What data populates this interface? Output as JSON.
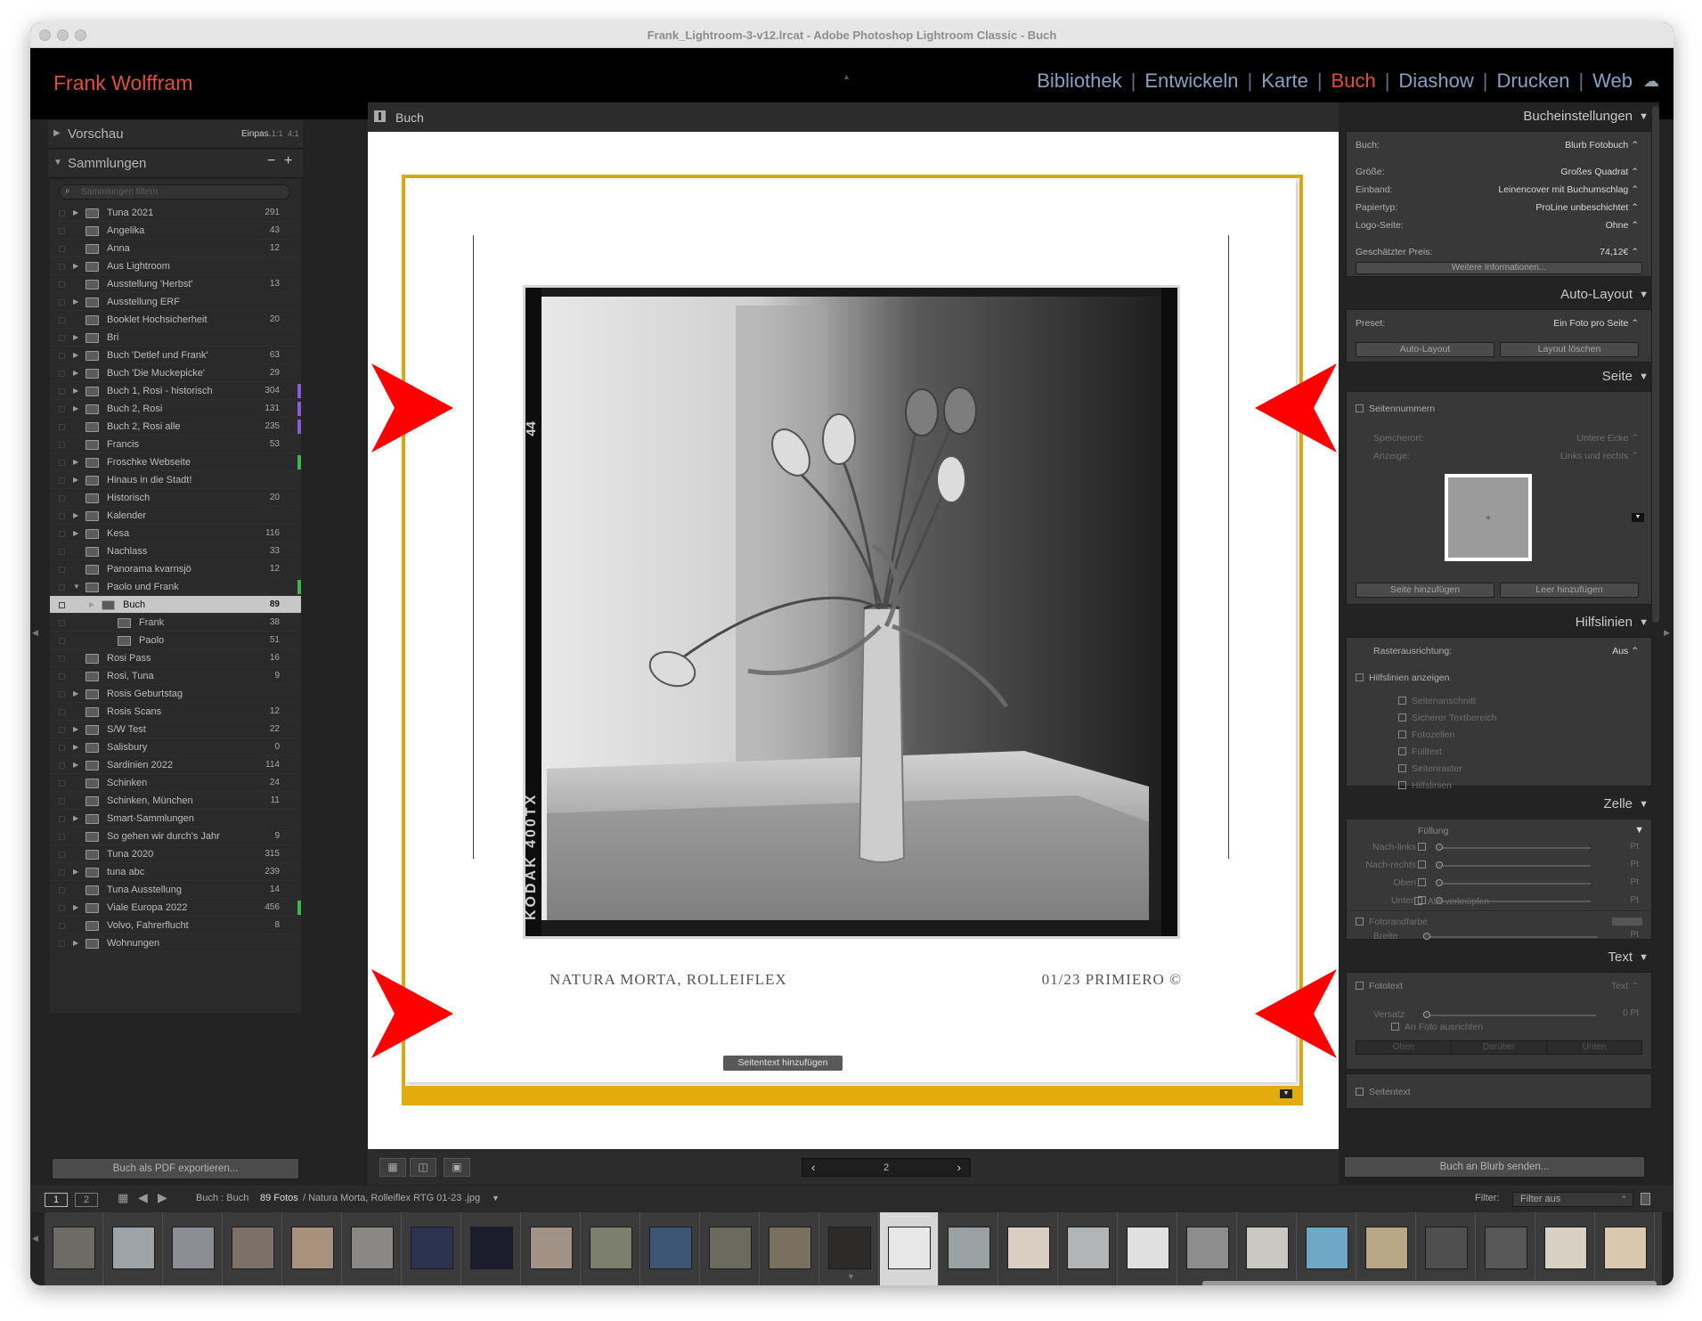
{
  "window": {
    "title": "Frank_Lightroom-3-v12.lrcat - Adobe Photoshop Lightroom Classic - Buch"
  },
  "identity_plate": "Frank Wolffram",
  "modules": [
    {
      "label": "Bibliothek",
      "active": false
    },
    {
      "label": "Entwickeln",
      "active": false
    },
    {
      "label": "Karte",
      "active": false
    },
    {
      "label": "Buch",
      "active": true
    },
    {
      "label": "Diashow",
      "active": false
    },
    {
      "label": "Drucken",
      "active": false
    },
    {
      "label": "Web",
      "active": false
    }
  ],
  "left": {
    "preview": {
      "label": "Vorschau",
      "fit": "Einpas.",
      "z1": "1:1",
      "z2": "4:1"
    },
    "collections": {
      "label": "Sammlungen",
      "search_placeholder": "Sammlungen filtern",
      "items": [
        {
          "name": "Tuna 2021",
          "count": "291",
          "expand": true,
          "tag": ""
        },
        {
          "name": "Angelika",
          "count": "43",
          "expand": false,
          "tag": ""
        },
        {
          "name": "Anna",
          "count": "12",
          "expand": false,
          "tag": ""
        },
        {
          "name": "Aus Lightroom",
          "count": "",
          "expand": true,
          "tag": ""
        },
        {
          "name": "Ausstellung 'Herbst'",
          "count": "13",
          "expand": false,
          "tag": ""
        },
        {
          "name": "Ausstellung ERF",
          "count": "",
          "expand": true,
          "tag": ""
        },
        {
          "name": "Booklet Hochsicherheit",
          "count": "20",
          "expand": false,
          "tag": ""
        },
        {
          "name": "Bri",
          "count": "",
          "expand": true,
          "tag": ""
        },
        {
          "name": "Buch 'Detlef und Frank'",
          "count": "63",
          "expand": true,
          "tag": ""
        },
        {
          "name": "Buch 'Die Muckepicke'",
          "count": "29",
          "expand": true,
          "tag": ""
        },
        {
          "name": "Buch 1, Rosi - historisch",
          "count": "304",
          "expand": true,
          "tag": "#8a5bd6"
        },
        {
          "name": "Buch 2, Rosi",
          "count": "131",
          "expand": true,
          "tag": "#8a5bd6"
        },
        {
          "name": "Buch 2, Rosi alle",
          "count": "235",
          "expand": false,
          "tag": "#8a5bd6"
        },
        {
          "name": "Francis",
          "count": "53",
          "expand": false,
          "tag": ""
        },
        {
          "name": "Froschke Webseite",
          "count": "",
          "expand": true,
          "tag": "#3fb34f"
        },
        {
          "name": "Hinaus in die Stadt!",
          "count": "",
          "expand": true,
          "tag": ""
        },
        {
          "name": "Historisch",
          "count": "20",
          "expand": false,
          "tag": ""
        },
        {
          "name": "Kalender",
          "count": "",
          "expand": true,
          "tag": ""
        },
        {
          "name": "Kesa",
          "count": "116",
          "expand": true,
          "tag": ""
        },
        {
          "name": "Nachlass",
          "count": "33",
          "expand": false,
          "tag": ""
        },
        {
          "name": "Panorama kvarnsjö",
          "count": "12",
          "expand": false,
          "tag": ""
        },
        {
          "name": "Paolo und Frank",
          "count": "",
          "expand": true,
          "open": true,
          "tag": "#3fb34f"
        },
        {
          "name": "Buch",
          "count": "89",
          "expand": true,
          "selected": true,
          "level": 1,
          "tag": ""
        },
        {
          "name": "Frank",
          "count": "38",
          "expand": false,
          "level": 2,
          "tag": ""
        },
        {
          "name": "Paolo",
          "count": "51",
          "expand": false,
          "level": 2,
          "tag": ""
        },
        {
          "name": "Rosi Pass",
          "count": "16",
          "expand": false,
          "tag": ""
        },
        {
          "name": "Rosi, Tuna",
          "count": "9",
          "expand": false,
          "tag": ""
        },
        {
          "name": "Rosis Geburtstag",
          "count": "",
          "expand": true,
          "tag": ""
        },
        {
          "name": "Rosis Scans",
          "count": "12",
          "expand": false,
          "tag": ""
        },
        {
          "name": "S/W Test",
          "count": "22",
          "expand": true,
          "tag": ""
        },
        {
          "name": "Salisbury",
          "count": "0",
          "expand": true,
          "tag": ""
        },
        {
          "name": "Sardinien 2022",
          "count": "114",
          "expand": true,
          "tag": ""
        },
        {
          "name": "Schinken",
          "count": "24",
          "expand": false,
          "tag": ""
        },
        {
          "name": "Schinken, München",
          "count": "11",
          "expand": false,
          "tag": ""
        },
        {
          "name": "Smart-Sammlungen",
          "count": "",
          "expand": true,
          "tag": ""
        },
        {
          "name": "So gehen wir durch's Jahr",
          "count": "9",
          "expand": false,
          "tag": ""
        },
        {
          "name": "Tuna 2020",
          "count": "315",
          "expand": false,
          "tag": ""
        },
        {
          "name": "tuna abc",
          "count": "239",
          "expand": true,
          "tag": ""
        },
        {
          "name": "Tuna Ausstellung",
          "count": "14",
          "expand": false,
          "tag": ""
        },
        {
          "name": "Viale Europa 2022",
          "count": "456",
          "expand": true,
          "tag": "#3fb34f"
        },
        {
          "name": "Volvo, Fahrerflucht",
          "count": "8",
          "expand": false,
          "tag": ""
        },
        {
          "name": "Wohnungen",
          "count": "",
          "expand": true,
          "tag": ""
        }
      ]
    },
    "export_button": "Buch als PDF exportieren..."
  },
  "center": {
    "header": "Buch",
    "caption_left": "NATURA MORTA, ROLLEIFLEX",
    "caption_right": "01/23 PRIMIERO ©",
    "film_edge": "KODAK 400TX",
    "frame_no": "44",
    "add_page_text": "Seitentext hinzufügen",
    "page_number": "2"
  },
  "right": {
    "book_settings": {
      "header": "Bucheinstellungen",
      "book_label": "Buch:",
      "book_value": "Blurb Fotobuch",
      "size_label": "Größe:",
      "size_value": "Großes Quadrat",
      "cover_label": "Einband:",
      "cover_value": "Leinencover mit Buchumschlag",
      "paper_label": "Papiertyp:",
      "paper_value": "ProLine unbeschichtet",
      "logo_label": "Logo-Seite:",
      "logo_value": "Ohne",
      "price_label": "Geschätzter Preis:",
      "price_value": "74,12€",
      "more_info": "Weitere Informationen..."
    },
    "auto_layout": {
      "header": "Auto-Layout",
      "preset_label": "Preset:",
      "preset_value": "Ein Foto pro Seite",
      "auto_btn": "Auto-Layout",
      "clear_btn": "Layout löschen"
    },
    "page": {
      "header": "Seite",
      "page_numbers": "Seitennummern",
      "location_label": "Speicherort:",
      "location_value": "Untere Ecke",
      "display_label": "Anzeige:",
      "display_value": "Links und rechts",
      "add_page": "Seite hinzufügen",
      "add_blank": "Leer hinzufügen"
    },
    "guides": {
      "header": "Hilfslinien",
      "grid_label": "Rasterausrichtung:",
      "grid_value": "Aus",
      "show": "Hilfslinien anzeigen",
      "items": [
        "Seitenanschnitt",
        "Sicherer Textbereich",
        "Fotozellen",
        "Fülltext",
        "Seitenraster",
        "Hilfslinien"
      ]
    },
    "cell": {
      "header": "Zelle",
      "padding": "Füllung",
      "sides": [
        "Nach-links",
        "Nach-rechts",
        "Oben",
        "Unten"
      ],
      "unit": "Pt",
      "link_all": "Alle verknüpfen",
      "photo_border": "Fotorandfarbe",
      "width": "Breite"
    },
    "text": {
      "header": "Text",
      "photo_text": "Fototext",
      "photo_text_value": "Text",
      "offset": "Versatz",
      "offset_value": "0 Pt",
      "align": "An Foto ausrichten",
      "pos": [
        "Oben",
        "Darüber",
        "Unten"
      ],
      "page_text": "Seitentext"
    },
    "send_button": "Buch an Blurb senden..."
  },
  "filmstrip": {
    "page1": "1",
    "page2": "2",
    "source_prefix": "Buch : Buch",
    "count": "89 Fotos",
    "filename": "/  Natura Morta, Rolleiflex RTG 01-23 .jpg",
    "filter_label": "Filter:",
    "filter_value": "Filter aus",
    "thumbs": [
      "#6e6a66",
      "#9ea3a8",
      "#8a8d92",
      "#7d7066",
      "#a8927e",
      "#8b8784",
      "#2b3350",
      "#1c1d2c",
      "#a29285",
      "#7d7f6e",
      "#3f5576",
      "#6c6a5c",
      "#7a7060",
      "#2d2b29",
      "#e7e7e7",
      "#9aa1a4",
      "#d8cfc2",
      "#b2b5b8",
      "#e0e0e0",
      "#8d8d8d",
      "#cbc8c4",
      "#6fa8c7",
      "#b9a685",
      "#4f4f4f",
      "#575757",
      "#d9d0c4",
      "#d9c8ae"
    ]
  },
  "colors": {
    "active_module": "#e0513a",
    "module": "#87a1c3",
    "spread_frame": "#e3ab0c",
    "arrows": "#ff0000"
  }
}
